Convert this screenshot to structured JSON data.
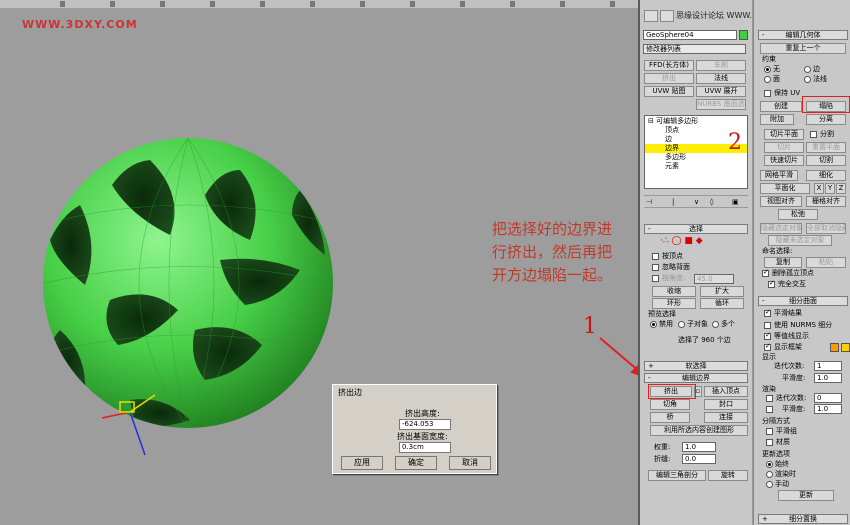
{
  "watermark": "WWW.3DXY.COM",
  "viewport_note": "把选择好的边界进行挤出，然后再把开方边塌陷一起。",
  "annotation_numbers": {
    "one": "1",
    "two": "2"
  },
  "command_panel": {
    "object_name": "GeoSphere04",
    "object_color": "#3fcf3f",
    "modifier_list": "修改器列表",
    "top_right_text": "思缘设计论坛 WWW.MISSYUAN.COM",
    "modifier_buttons": [
      {
        "label": "FFD(长方体)",
        "enabled": true
      },
      {
        "label": "车削",
        "enabled": false
      },
      {
        "label": "挤出",
        "enabled": false
      },
      {
        "label": "法线",
        "enabled": true
      },
      {
        "label": "UVW 贴图",
        "enabled": true
      },
      {
        "label": "UVW 展开",
        "enabled": true
      },
      {
        "label": "NURBS 曲面选择",
        "enabled": false
      }
    ],
    "stack": {
      "root": "可编辑多边形",
      "items": [
        "顶点",
        "边",
        "边界",
        "多边形",
        "元素"
      ],
      "selected": "边界"
    },
    "selection": {
      "title": "选择",
      "by_vertex": "按顶点",
      "ignore_backfacing": "忽略背面",
      "by_angle": "按角度:",
      "angle_value": "45.0",
      "shrink": "收缩",
      "grow": "扩大",
      "ring": "环形",
      "loop": "循环",
      "preview_title": "预览选择",
      "preview_options": [
        "禁用",
        "子对象",
        "多个"
      ],
      "status": "选择了 960 个边"
    },
    "soft_selection": {
      "title": "软选择"
    },
    "edit_borders": {
      "title": "编辑边界",
      "extrude": "挤出",
      "insert_vertex": "插入顶点",
      "chamfer": "切角",
      "cap": "封口",
      "bridge": "桥",
      "connect": "连接",
      "create_shape": "利用所选内容创建图形",
      "weight_label": "权重:",
      "weight_value": "1.0",
      "crease_label": "折缝:",
      "crease_value": "0.0",
      "edit_tri": "编辑三角剖分",
      "turn": "旋转"
    }
  },
  "edit_geometry": {
    "title": "编辑几何体",
    "repeat_last": "重复上一个",
    "constraints_title": "约束",
    "constraints": [
      "无",
      "边",
      "面",
      "法线"
    ],
    "preserve_uv": "保持 UV",
    "create": "创建",
    "collapse": "塌陷",
    "attach": "附加",
    "detach": "分离",
    "slice_plane": "切片平面",
    "split": "分割",
    "slice": "切片",
    "reset_plane": "重置平面",
    "quickslice": "快速切片",
    "cut": "切割",
    "meshsmooth": "网格平滑",
    "tessellate": "细化",
    "make_planar": "平面化",
    "xyz": [
      "X",
      "Y",
      "Z"
    ],
    "view_align": "视图对齐",
    "grid_align": "栅格对齐",
    "relax": "松弛",
    "hide_selected": "隐藏选定对象",
    "unhide_all": "全部取消隐藏",
    "hide_unselected": "隐藏未选定对象",
    "named_sel": "命名选择:",
    "copy": "复制",
    "paste": "粘贴",
    "delete_isolated": "删除孤立顶点",
    "full_interactivity": "完全交互"
  },
  "subdivision_surface": {
    "title": "细分曲面",
    "smooth_result": "平滑结果",
    "use_nurms": "使用 NURMS 细分",
    "isoline": "等值线显示",
    "show_cage": "显示框架",
    "cage_colors": [
      "#ff9900",
      "#ffd000"
    ],
    "display_title": "显示",
    "iterations_label": "迭代次数:",
    "iterations_display": "1",
    "smoothness_label": "平滑度:",
    "smoothness_display": "1.0",
    "render_title": "渲染",
    "render_iterations": "0",
    "render_smoothness": "1.0",
    "separate_title": "分隔方式",
    "smoothing_groups": "平滑组",
    "materials": "材质",
    "update_title": "更新选项",
    "update_options": [
      "始终",
      "渲染时",
      "手动"
    ],
    "update_button": "更新",
    "disp_title": "细分置换"
  },
  "dialog": {
    "title": "挤出边",
    "height_label": "挤出高度:",
    "height_value": "-624.053",
    "base_width_label": "挤出基面宽度:",
    "base_width_value": "0.3cm",
    "apply": "应用",
    "ok": "确定",
    "cancel": "取消"
  },
  "colors": {
    "annotation_red": "#e02020",
    "sphere_green": "#4cd84c",
    "selection_yellow": "#ffee00"
  }
}
